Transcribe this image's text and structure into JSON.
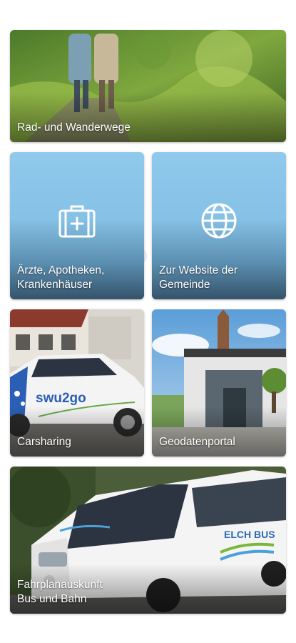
{
  "tiles": {
    "hiking": {
      "label": "Rad- und Wanderwege"
    },
    "doctors": {
      "label": "Ärzte, Apotheken,\nKrankenhäuser",
      "icon": "medical-kit-icon"
    },
    "website": {
      "label": "Zur Website der\nGemeinde",
      "icon": "globe-icon"
    },
    "carsharing": {
      "label": "Carsharing",
      "car_brand": "swu2go"
    },
    "geodata": {
      "label": "Geodatenportal"
    },
    "transit": {
      "label": "Fahrplanauskunft\nBus und Bahn",
      "bus_brand": "ELCH BUS"
    }
  },
  "colors": {
    "tile_blue_top": "#8fc9ec",
    "tile_blue_bottom": "#35536a"
  }
}
